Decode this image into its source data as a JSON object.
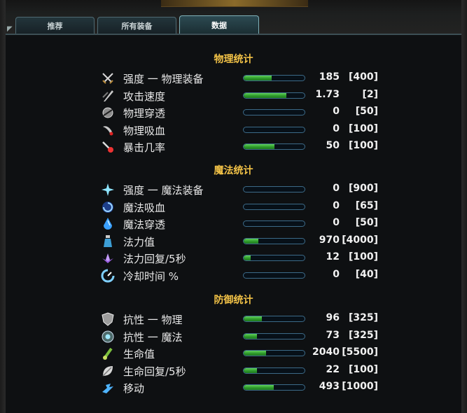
{
  "tabs": [
    {
      "label": "推荐",
      "active": false
    },
    {
      "label": "所有装备",
      "active": false
    },
    {
      "label": "数据",
      "active": true
    }
  ],
  "sections": [
    {
      "title": "物理统计",
      "rows": [
        {
          "icon": "crossed-swords-icon",
          "label": "强度 一 物理装备",
          "value": "185",
          "max": "[400]",
          "fill": 0.46
        },
        {
          "icon": "attack-speed-icon",
          "label": "攻击速度",
          "value": "1.73",
          "max": "[2]",
          "fill": 0.7
        },
        {
          "icon": "penetration-icon",
          "label": "物理穿透",
          "value": "0",
          "max": "[50]",
          "fill": 0
        },
        {
          "icon": "lifesteal-icon",
          "label": "物理吸血",
          "value": "0",
          "max": "[100]",
          "fill": 0
        },
        {
          "icon": "critical-icon",
          "label": "暴击几率",
          "value": "50",
          "max": "[100]",
          "fill": 0.5
        }
      ]
    },
    {
      "title": "魔法统计",
      "rows": [
        {
          "icon": "magic-star-icon",
          "label": "强度 一 魔法装备",
          "value": "0",
          "max": "[900]",
          "fill": 0
        },
        {
          "icon": "magic-vortex-icon",
          "label": "魔法吸血",
          "value": "0",
          "max": "[65]",
          "fill": 0
        },
        {
          "icon": "magic-pen-drop-icon",
          "label": "魔法穿透",
          "value": "0",
          "max": "[50]",
          "fill": 0
        },
        {
          "icon": "mana-potion-icon",
          "label": "法力值",
          "value": "970",
          "max": "[4000]",
          "fill": 0.24
        },
        {
          "icon": "mana-regen-flower-icon",
          "label": "法力回复/5秒",
          "value": "12",
          "max": "[100]",
          "fill": 0.12
        },
        {
          "icon": "cooldown-icon",
          "label": "冷却时间 %",
          "value": "0",
          "max": "[40]",
          "fill": 0
        }
      ]
    },
    {
      "title": "防御统计",
      "rows": [
        {
          "icon": "shield-icon",
          "label": "抗性 一 物理",
          "value": "96",
          "max": "[325]",
          "fill": 0.3
        },
        {
          "icon": "magic-shield-icon",
          "label": "抗性 一 魔法",
          "value": "73",
          "max": "[325]",
          "fill": 0.22
        },
        {
          "icon": "health-potion-icon",
          "label": "生命值",
          "value": "2040",
          "max": "[5500]",
          "fill": 0.37
        },
        {
          "icon": "health-regen-leaf-icon",
          "label": "生命回复/5秒",
          "value": "22",
          "max": "[100]",
          "fill": 0.22
        },
        {
          "icon": "movement-icon",
          "label": "移动",
          "value": "493",
          "max": "[1000]",
          "fill": 0.49
        }
      ]
    }
  ],
  "colors": {
    "title_gold": "#f2c247",
    "bar_green": "#2d9a2b",
    "bar_border": "#3c6a88"
  }
}
